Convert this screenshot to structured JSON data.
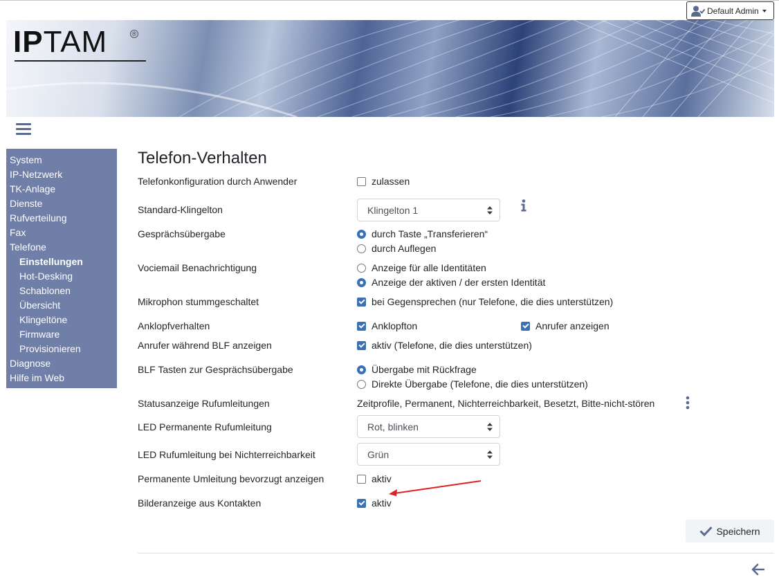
{
  "user_menu": {
    "label": "Default Admin"
  },
  "logo": {
    "text_bold": "IP",
    "text_rest": "TAM",
    "registered": "®"
  },
  "sidebar": {
    "items": [
      {
        "label": "System",
        "sub": false,
        "active": false
      },
      {
        "label": "IP-Netzwerk",
        "sub": false,
        "active": false
      },
      {
        "label": "TK-Anlage",
        "sub": false,
        "active": false
      },
      {
        "label": "Dienste",
        "sub": false,
        "active": false
      },
      {
        "label": "Rufverteilung",
        "sub": false,
        "active": false
      },
      {
        "label": "Fax",
        "sub": false,
        "active": false
      },
      {
        "label": "Telefone",
        "sub": false,
        "active": false
      },
      {
        "label": "Einstellungen",
        "sub": true,
        "active": true
      },
      {
        "label": "Hot-Desking",
        "sub": true,
        "active": false
      },
      {
        "label": "Schablonen",
        "sub": true,
        "active": false
      },
      {
        "label": "Übersicht",
        "sub": true,
        "active": false
      },
      {
        "label": "Klingeltöne",
        "sub": true,
        "active": false
      },
      {
        "label": "Firmware",
        "sub": true,
        "active": false
      },
      {
        "label": "Provisionieren",
        "sub": true,
        "active": false
      },
      {
        "label": "Diagnose",
        "sub": false,
        "active": false
      },
      {
        "label": "Hilfe im Web",
        "sub": false,
        "active": false
      }
    ]
  },
  "page": {
    "title": "Telefon-Verhalten"
  },
  "form": {
    "user_config": {
      "label": "Telefonkonfiguration durch Anwender",
      "option": "zulassen",
      "checked": false
    },
    "ringtone": {
      "label": "Standard-Klingelton",
      "value": "Klingelton 1"
    },
    "transfer": {
      "label": "Gesprächsübergabe",
      "opt1": "durch Taste „Transferieren“",
      "opt2": "durch Auflegen",
      "selected": 1
    },
    "voicemail": {
      "label": "Vociemail Benachrichtigung",
      "opt1": "Anzeige für alle Identitäten",
      "opt2": "Anzeige der aktiven / der ersten Identität",
      "selected": 2
    },
    "mic_mute": {
      "label": "Mikrophon stummgeschaltet",
      "option": "bei Gegensprechen (nur Telefone, die dies unterstützen)",
      "checked": true
    },
    "call_waiting": {
      "label": "Anklopfverhalten",
      "opt1": "Anklopfton",
      "opt2": "Anrufer anzeigen",
      "checked1": true,
      "checked2": true
    },
    "blf_caller": {
      "label": "Anrufer während BLF anzeigen",
      "option": "aktiv (Telefone, die dies unterstützen)",
      "checked": true
    },
    "blf_transfer": {
      "label": "BLF Tasten zur Gesprächsübergabe",
      "opt1": "Übergabe mit Rückfrage",
      "opt2": "Direkte Übergabe (Telefone, die dies unterstützen)",
      "selected": 1
    },
    "status_forward": {
      "label": "Statusanzeige Rufumleitungen",
      "value": "Zeitprofile, Permanent, Nichterreichbarkeit, Besetzt, Bitte-nicht-stören"
    },
    "led_permanent": {
      "label": "LED Permanente Rufumleitung",
      "value": "Rot, blinken"
    },
    "led_unreachable": {
      "label": "LED Rufumleitung bei Nichterreichbarkeit",
      "value": "Grün"
    },
    "perm_forward_pref": {
      "label": "Permanente Umleitung bevorzugt anzeigen",
      "option": "aktiv",
      "checked": false
    },
    "contact_images": {
      "label": "Bilderanzeige aus Kontakten",
      "option": "aktiv",
      "checked": true
    }
  },
  "actions": {
    "save_label": "Speichern"
  },
  "colors": {
    "sidebar_bg": "#6f7fa8",
    "accent": "#3b6fb6",
    "annotation_arrow": "#e02020"
  }
}
